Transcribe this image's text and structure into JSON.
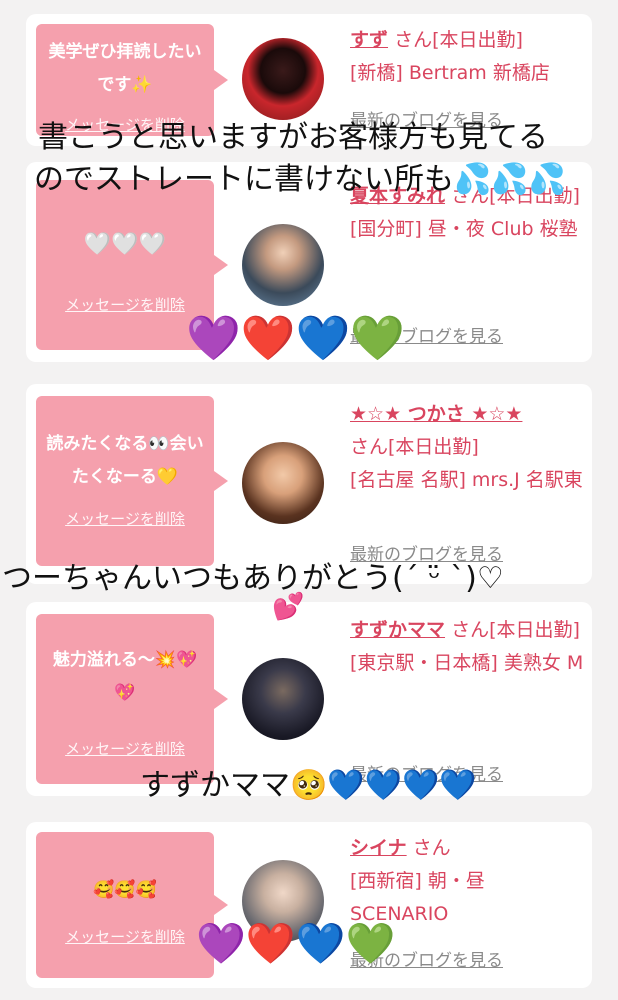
{
  "cards": [
    {
      "message": "美学ぜひ拝読したいです✨",
      "delete_label": "メッセージを削除",
      "name": "すず",
      "san": "さん[本日出勤]",
      "shop": "[新橋] Bertram 新橋店",
      "blog_label": "最新のブログを見る"
    },
    {
      "message": "🤍🤍🤍",
      "delete_label": "メッセージを削除",
      "name": "夏本すみれ",
      "san": "さん[本日出勤]",
      "shop": "[国分町] 昼・夜 Club 桜塾",
      "blog_label": "最新のブログを見る"
    },
    {
      "message": "読みたくなる👀会いたくなーる💛",
      "delete_label": "メッセージを削除",
      "name": "★☆★ つかさ ★☆★",
      "san": "さん[本日出勤]",
      "shop": "[名古屋 名駅] mrs.J 名駅東",
      "blog_label": "最新のブログを見る"
    },
    {
      "message": "魅力溢れる〜💥💖💖",
      "delete_label": "メッセージを削除",
      "name": "すずかママ",
      "san": "さん[本日出勤]",
      "shop": "[東京駅・日本橋] 美熟女 M",
      "blog_label": "最新のブログを見る"
    },
    {
      "message": "🥰🥰🥰",
      "delete_label": "メッセージを削除",
      "name": "シイナ",
      "san": "さん",
      "shop": "[西新宿] 朝・昼 SCENARIO",
      "blog_label": "最新のブログを見る"
    }
  ],
  "overlays": {
    "caption_1_line1": "書こうと思いますがお客様方も見てる",
    "caption_1_line2": "のでストレートに書けない所も💦💦💦",
    "caption_2": "つーちゃんいつもありがとう(´ ᵕ̈ `)♡",
    "caption_2_emoji": "💕",
    "caption_3": "すずかママ🥺💙💙💙💙"
  },
  "hearts_row_1": [
    "💜",
    "❤️",
    "💙",
    "💚"
  ],
  "hearts_row_2": [
    "💜",
    "❤️",
    "💙",
    "💚"
  ],
  "colors": {
    "accent_pink": "#d9455f",
    "bubble_pink": "#f5a0ad",
    "background": "#f3f2f2"
  }
}
